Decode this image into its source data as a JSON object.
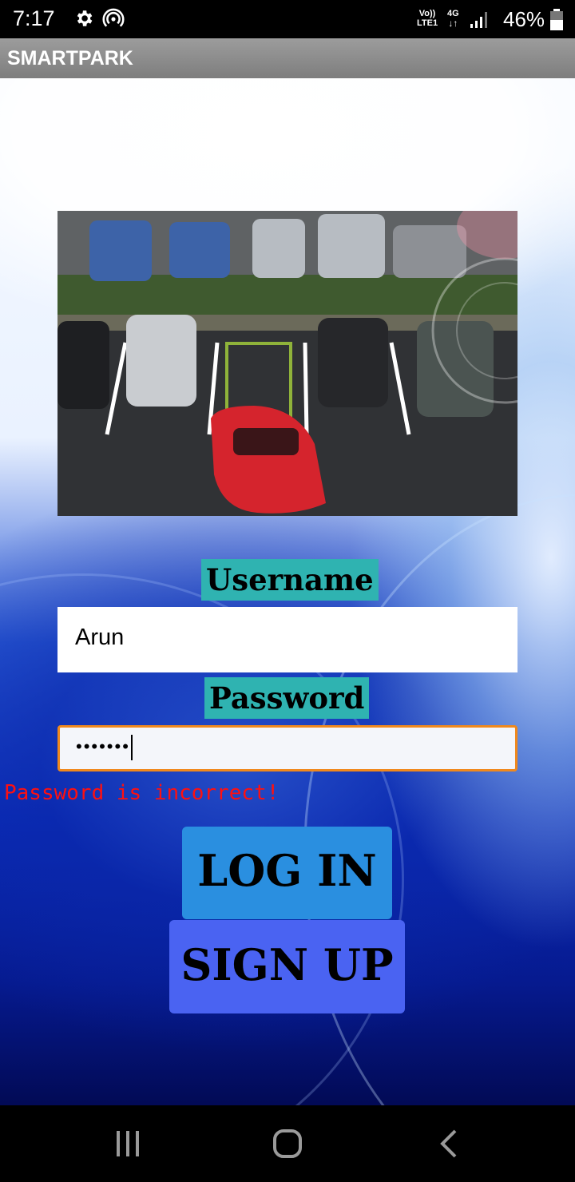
{
  "status_bar": {
    "time": "7:17",
    "network_label_top": "Vo)) ",
    "network_label_bottom": "LTE1",
    "network_type": "4G",
    "battery_percent": "46%"
  },
  "app_bar": {
    "title": "SMARTPARK"
  },
  "form": {
    "username_label": "Username",
    "username_value": "Arun",
    "password_label": "Password",
    "password_masked": "•••••••",
    "error_message": "Password is incorrect!",
    "login_button": "LOG IN",
    "signup_button": "SIGN UP"
  },
  "icons": {
    "settings": "gear-icon",
    "hotspot": "hotspot-icon",
    "signal": "signal-bars-icon",
    "battery": "battery-icon",
    "recents": "recents-icon",
    "home": "home-icon",
    "back": "back-icon"
  },
  "colors": {
    "label_bg": "#2fb3b1",
    "login_bg": "#2a8fe0",
    "signup_bg": "#4a63f2",
    "error": "#ff1010",
    "focus_border": "#f0891d"
  }
}
